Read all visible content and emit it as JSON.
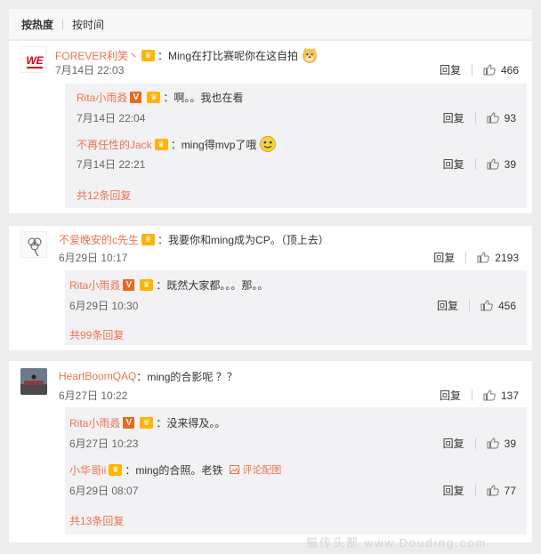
{
  "sort": {
    "hot": "按热度",
    "time": "按时间"
  },
  "comments": [
    {
      "user": "FOREVER利笑丶",
      "text": "：Ming在打比赛呢你在这自拍",
      "time": "7月14日 22:03",
      "reply_label": "回复",
      "likes": "466",
      "avatar_logo": "WE",
      "replies": [
        {
          "user": "Rita小雨叒",
          "text": "：啊。。我也在看",
          "time": "7月14日 22:04",
          "reply_label": "回复",
          "likes": "93"
        },
        {
          "user": "不再任性的Jack",
          "text": "：ming得mvp了哦",
          "time": "7月14日 22:21",
          "reply_label": "回复",
          "likes": "39"
        }
      ],
      "more": "共12条回复"
    },
    {
      "user": "不爱晚安的c先生",
      "text": "：我要你和ming成为CP。（顶上去）",
      "time": "6月29日 10:17",
      "reply_label": "回复",
      "likes": "2193",
      "replies": [
        {
          "user": "Rita小雨叒",
          "text": "：既然大家都。。。那。。",
          "time": "6月29日 10:30",
          "reply_label": "回复",
          "likes": "456"
        }
      ],
      "more": "共99条回复"
    },
    {
      "user": "HeartBoomQAQ",
      "text": "：ming的合影呢 ？？",
      "time": "6月27日 10:22",
      "reply_label": "回复",
      "likes": "137",
      "replies": [
        {
          "user": "Rita小雨叒",
          "text": "：没来得及。。",
          "time": "6月27日 10:23",
          "reply_label": "回复",
          "likes": "39"
        },
        {
          "user": "小华哥ii",
          "text": "：ming的合照。老铁",
          "extra": "评论配图",
          "time": "6月29日 08:07",
          "reply_label": "回复",
          "likes": "77"
        }
      ],
      "more": "共13条回复"
    }
  ],
  "watermark": "猫传头部 www.Douding.com",
  "colors": {
    "username": "#eb7350",
    "badge": "#ffb400",
    "verified": "#e86a1c"
  }
}
